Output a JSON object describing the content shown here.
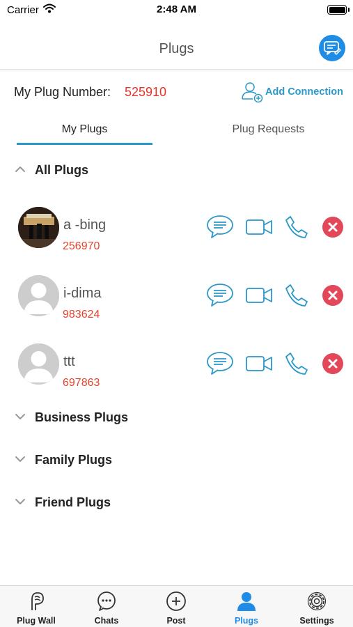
{
  "status_bar": {
    "carrier": "Carrier",
    "time": "2:48 AM"
  },
  "header": {
    "title": "Plugs"
  },
  "plug_number": {
    "label": "My Plug Number:",
    "value": "525910"
  },
  "add_connection": {
    "label": "Add Connection"
  },
  "tabs": [
    {
      "label": "My Plugs",
      "active": true
    },
    {
      "label": "Plug Requests",
      "active": false
    }
  ],
  "groups": [
    {
      "title": "All Plugs",
      "expanded": true,
      "contacts": [
        {
          "name": "a -bing",
          "number": "256970",
          "avatar": "photo"
        },
        {
          "name": "i-dima",
          "number": "983624",
          "avatar": "placeholder"
        },
        {
          "name": "ttt",
          "number": "697863",
          "avatar": "placeholder"
        }
      ]
    },
    {
      "title": "Business Plugs",
      "expanded": false
    },
    {
      "title": "Family Plugs",
      "expanded": false
    },
    {
      "title": "Friend Plugs",
      "expanded": false
    }
  ],
  "tab_bar": [
    {
      "label": "Plug Wall",
      "icon": "plug-wall-icon",
      "active": false
    },
    {
      "label": "Chats",
      "icon": "chat-bubble-icon",
      "active": false
    },
    {
      "label": "Post",
      "icon": "plus-circle-icon",
      "active": false
    },
    {
      "label": "Plugs",
      "icon": "person-icon",
      "active": true
    },
    {
      "label": "Settings",
      "icon": "gear-icon",
      "active": false
    }
  ],
  "colors": {
    "accent": "#2a98c9",
    "brand_blue": "#1f8ce6",
    "number_red": "#e7342a",
    "remove_red": "#e2475a"
  }
}
